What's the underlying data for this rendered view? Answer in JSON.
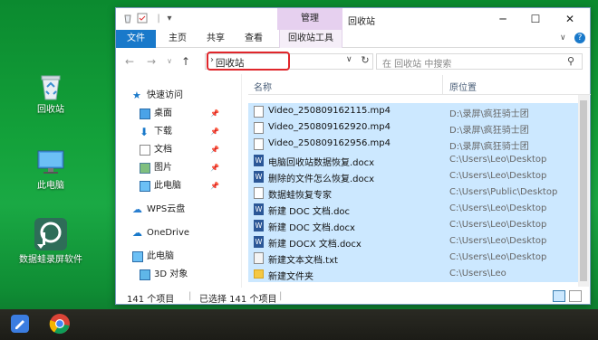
{
  "desktop": {
    "icons": [
      {
        "label": "回收站"
      },
      {
        "label": "此电脑"
      },
      {
        "label": "数据蛙录屏软件"
      }
    ]
  },
  "window": {
    "context_tab": "管理",
    "title": "回收站",
    "ribbon_tabs": [
      "文件",
      "主页",
      "共享",
      "查看",
      "回收站工具"
    ],
    "address": "回收站",
    "search_placeholder": "在 回收站 中搜索",
    "nav": [
      {
        "label": "快速访问",
        "pinned": false
      },
      {
        "label": "桌面",
        "pinned": true
      },
      {
        "label": "下载",
        "pinned": true
      },
      {
        "label": "文档",
        "pinned": true
      },
      {
        "label": "图片",
        "pinned": true
      },
      {
        "label": "此电脑",
        "pinned": true
      },
      {
        "label": "WPS云盘",
        "pinned": false
      },
      {
        "label": "OneDrive",
        "pinned": false
      },
      {
        "label": "此电脑",
        "pinned": false
      },
      {
        "label": "3D 对象",
        "pinned": false
      }
    ],
    "columns": {
      "name": "名称",
      "location": "原位置"
    },
    "files": [
      {
        "name": "Video_250809162115.mp4",
        "location": "D:\\录屏\\疯狂骑士团",
        "type": "video"
      },
      {
        "name": "Video_250809162920.mp4",
        "location": "D:\\录屏\\疯狂骑士团",
        "type": "video"
      },
      {
        "name": "Video_250809162956.mp4",
        "location": "D:\\录屏\\疯狂骑士团",
        "type": "video"
      },
      {
        "name": "电脑回收站数据恢复.docx",
        "location": "C:\\Users\\Leo\\Desktop",
        "type": "word"
      },
      {
        "name": "删除的文件怎么恢复.docx",
        "location": "C:\\Users\\Leo\\Desktop",
        "type": "word"
      },
      {
        "name": "数据蛙恢复专家",
        "location": "C:\\Users\\Public\\Desktop",
        "type": "shortcut"
      },
      {
        "name": "新建 DOC 文档.doc",
        "location": "C:\\Users\\Leo\\Desktop",
        "type": "word"
      },
      {
        "name": "新建 DOC 文档.docx",
        "location": "C:\\Users\\Leo\\Desktop",
        "type": "word"
      },
      {
        "name": "新建 DOCX 文档.docx",
        "location": "C:\\Users\\Leo\\Desktop",
        "type": "word"
      },
      {
        "name": "新建文本文档.txt",
        "location": "C:\\Users\\Leo\\Desktop",
        "type": "text"
      },
      {
        "name": "新建文件夹",
        "location": "C:\\Users\\Leo",
        "type": "folder"
      }
    ],
    "status": {
      "count": "141 个项目",
      "selected": "已选择 141 个项目"
    }
  },
  "colors": {
    "accent": "#1979ca",
    "selection": "#cce8ff",
    "highlight_box": "#e0262b"
  }
}
